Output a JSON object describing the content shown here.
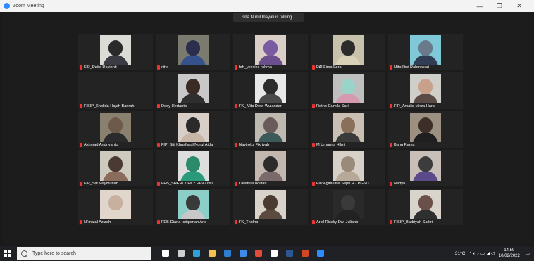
{
  "window": {
    "title": "Zoom Meeting"
  },
  "controls": {
    "minimize": "—",
    "maximize": "❐",
    "close": "✕"
  },
  "talking": "Isna Nurul Inayati is talking...",
  "participants": [
    {
      "name": "FIP_Reita Rayianti",
      "bg": "#dcdcd7",
      "head": "#2a2a2a",
      "body": "#3b3b44"
    },
    {
      "name": "citta",
      "bg": "#7a7a6f",
      "head": "#2b2f4d",
      "body": "#36528c"
    },
    {
      "name": "feb_yessika rahma",
      "bg": "#d9cfc7",
      "head": "#7a5aa0",
      "body": "#6b4f8f"
    },
    {
      "name": "PAI/Firsa Fera",
      "bg": "#c8c2ad",
      "head": "#2c2c2c",
      "body": "#d9d2b8"
    },
    {
      "name": "Mita Dwi Rahmasari",
      "bg": "#7ec8d8",
      "head": "#6a7a8a",
      "body": "#2f3e55"
    },
    {
      "name": "FISIP_Kholida Hajah Barirah",
      "bg": "#232323",
      "head": "#232323",
      "body": "#232323"
    },
    {
      "name": "Dedy Hertanto",
      "bg": "#c8c8c8",
      "head": "#3a2c24",
      "body": "#2f2f2f"
    },
    {
      "name": "FK_ Vita Dewi Wulandari",
      "bg": "#e8e8e8",
      "head": "#2c2c2c",
      "body": "#4a4a4a"
    },
    {
      "name": "Retno Gumila Sari",
      "bg": "#bfbfbf",
      "head": "#9ad4c9",
      "body": "#d69ab0"
    },
    {
      "name": "FIP_Amalia Mirza Hana",
      "bg": "#d0cec9",
      "head": "#c9a18a",
      "body": "#5a4a45"
    },
    {
      "name": "Akhmad Andriyanto",
      "bg": "#8a8070",
      "head": "#6d5a4a",
      "body": "#2b2b2b"
    },
    {
      "name": "FIP_Siti Khusfiatul Nurul Aida",
      "bg": "#d8d0c8",
      "head": "#2a2a2a",
      "body": "#c7b5a5"
    },
    {
      "name": "Nayirotul Fikriyah",
      "bg": "#bdb8b0",
      "head": "#6a5a5a",
      "body": "#3d5a5a"
    },
    {
      "name": "M Umamul Hilmi",
      "bg": "#c9bfb2",
      "head": "#8a6f5a",
      "body": "#3a3a3a"
    },
    {
      "name": "Bang Rama",
      "bg": "#9c9080",
      "head": "#3d2f28",
      "body": "#1f1f1f"
    },
    {
      "name": "FIP_Siti Maymunah",
      "bg": "#cfcac0",
      "head": "#4a3a34",
      "body": "#8b6c5c"
    },
    {
      "name": "FEB_SHERLY EKY PRATIWI",
      "bg": "#dedede",
      "head": "#2a8a6a",
      "body": "#2a9a7a"
    },
    {
      "name": "Lailatul Kholifah",
      "bg": "#c2b8b0",
      "head": "#2c2c2c",
      "body": "#7a6a6a"
    },
    {
      "name": "FIP Agita Dila Septi R - PGSD",
      "bg": "#d6d0c8",
      "head": "#9a8a7a",
      "body": "#b8a898"
    },
    {
      "name": "Nadya",
      "bg": "#c8c0b8",
      "head": "#3c3c3c",
      "body": "#5a4a8a"
    },
    {
      "name": "Ni'matul Azizah",
      "bg": "#e0d6cc",
      "head": "#c8b0a0",
      "body": "#e0d6cc"
    },
    {
      "name": "FEB-Diana Istiqomah Aris",
      "bg": "#8ccfc8",
      "head": "#3a3a3a",
      "body": "#c8c8c8"
    },
    {
      "name": "FK_Tholha",
      "bg": "#d8d2ca",
      "head": "#4a3a30",
      "body": "#5a4a40"
    },
    {
      "name": "Ariel Riscky Dwi Juliano",
      "bg": "#2a2a2a",
      "head": "#3a3a3a",
      "body": "#222222"
    },
    {
      "name": "FISIP_Badriyah Safitri",
      "bg": "#d8d4cc",
      "head": "#6a5048",
      "body": "#2f2f2f"
    }
  ],
  "taskbar": {
    "search_placeholder": "Type here to search",
    "icons": [
      {
        "name": "cortana-icon",
        "color": "#ffffff"
      },
      {
        "name": "task-view-icon",
        "color": "#cfcfcf"
      },
      {
        "name": "edge-icon",
        "color": "#2ea0d8"
      },
      {
        "name": "file-explorer-icon",
        "color": "#f2c14e"
      },
      {
        "name": "mail-icon",
        "color": "#2d7fd3"
      },
      {
        "name": "dropbox-icon",
        "color": "#3d8ae8"
      },
      {
        "name": "chrome-icon",
        "color": "#e24a3b"
      },
      {
        "name": "app-icon",
        "color": "#ffffff"
      },
      {
        "name": "word-icon",
        "color": "#2b5797"
      },
      {
        "name": "powerpoint-icon",
        "color": "#d24726"
      },
      {
        "name": "zoom-icon",
        "color": "#2d8cff"
      }
    ],
    "weather": "31°C",
    "time": "14.59",
    "date": "10/02/2022"
  }
}
